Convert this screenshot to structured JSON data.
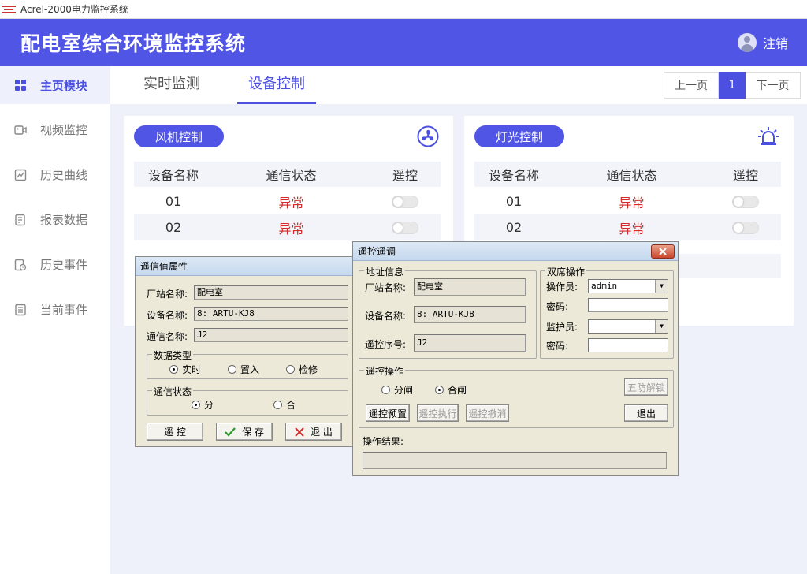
{
  "window": {
    "title": "Acrel-2000电力监控系统"
  },
  "header": {
    "title": "配电室综合环境监控系统",
    "logout_label": "注销"
  },
  "sidebar": {
    "items": [
      {
        "label": "主页模块",
        "icon": "dashboard-icon",
        "active": true
      },
      {
        "label": "视频监控",
        "icon": "video-icon"
      },
      {
        "label": "历史曲线",
        "icon": "chart-icon"
      },
      {
        "label": "报表数据",
        "icon": "report-icon"
      },
      {
        "label": "历史事件",
        "icon": "history-icon"
      },
      {
        "label": "当前事件",
        "icon": "list-icon"
      }
    ]
  },
  "tabs": [
    {
      "label": "实时监测"
    },
    {
      "label": "设备控制",
      "active": true
    }
  ],
  "pager": {
    "prev": "上一页",
    "current": "1",
    "next": "下一页"
  },
  "fan_card": {
    "button": "风机控制",
    "icon": "fan-icon",
    "headers": [
      "设备名称",
      "通信状态",
      "遥控"
    ],
    "rows": [
      {
        "name": "01",
        "status": "异常"
      },
      {
        "name": "02",
        "status": "异常"
      }
    ]
  },
  "light_card": {
    "button": "灯光控制",
    "icon": "alarm-light-icon",
    "headers": [
      "设备名称",
      "通信状态",
      "遥控"
    ],
    "rows": [
      {
        "name": "01",
        "status": "异常"
      },
      {
        "name": "02",
        "status": "异常"
      }
    ]
  },
  "dialog_props": {
    "title": "遥信值属性",
    "station_label": "厂站名称:",
    "station_value": "配电室",
    "device_label": "设备名称:",
    "device_value": "8: ARTU-KJ8",
    "comm_label": "通信名称:",
    "comm_value": "J2",
    "data_type_group": "数据类型",
    "data_types": [
      "实时",
      "置入",
      "检修"
    ],
    "comm_state_group": "通信状态",
    "comm_states": [
      "分",
      "合"
    ],
    "btn_remote": "遥  控",
    "btn_save": "保  存",
    "btn_exit": "退  出"
  },
  "dialog_remote": {
    "title": "遥控遥调",
    "addr_group": "地址信息",
    "station_label": "厂站名称:",
    "station_value": "配电室",
    "device_label": "设备名称:",
    "device_value": "8: ARTU-KJ8",
    "seq_label": "遥控序号:",
    "seq_value": "J2",
    "dual_group": "双席操作",
    "operator_label": "操作员:",
    "operator_value": "admin",
    "pwd_label": "密码:",
    "guardian_label": "监护员:",
    "guardian_value": "",
    "pwd2_label": "密码:",
    "op_group": "遥控操作",
    "op_options": [
      "分闸",
      "合闸"
    ],
    "btn_unlock": "五防解锁",
    "btn_preset": "遥控预置",
    "btn_execute": "遥控执行",
    "btn_cancel": "遥控撤消",
    "btn_exit": "退出",
    "result_label": "操作结果:",
    "result_value": ""
  }
}
